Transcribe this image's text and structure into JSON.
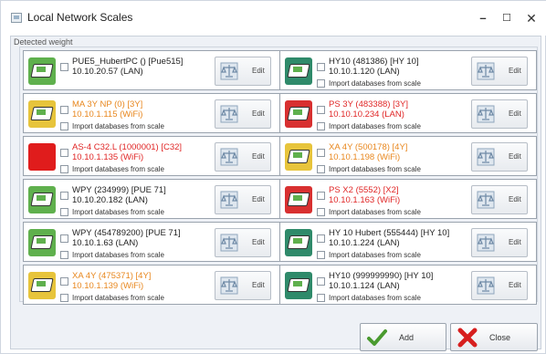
{
  "window": {
    "title": "Local Network Scales"
  },
  "group_label": "Detected weight",
  "colors": {
    "online": "#222222",
    "offline": "#e8871e",
    "error": "#e02626"
  },
  "cards": [
    {
      "name": "PUE5_HubertPC () [Pue515]",
      "address": "10.10.20.57 (LAN)",
      "status": "online",
      "icon_bg": "#5fb04d",
      "import_label": "",
      "edit_label": "Edit"
    },
    {
      "name": "HY10 (481386) [HY 10]",
      "address": "10.10.1.120 (LAN)",
      "status": "online",
      "icon_bg": "#2f8a6a",
      "import_label": "Import databases from scale",
      "edit_label": "Edit"
    },
    {
      "name": "MA 3Y NP (0) [3Y]",
      "address": "10.10.1.115 (WiFi)",
      "status": "offline",
      "icon_bg": "#e7c43b",
      "import_label": "Import databases from scale",
      "edit_label": "Edit"
    },
    {
      "name": "PS 3Y (483388) [3Y]",
      "address": "10.10.10.234 (LAN)",
      "status": "error",
      "icon_bg": "#d83030",
      "import_label": "Import databases from scale",
      "edit_label": "Edit"
    },
    {
      "name": "AS-4 C32.L (1000001) [C32]",
      "address": "10.10.1.135 (WiFi)",
      "status": "error",
      "icon_bg": "#e01c1c",
      "import_label": "Import databases from scale",
      "edit_label": "Edit"
    },
    {
      "name": "XA 4Y (500178) [4Y]",
      "address": "10.10.1.198 (WiFi)",
      "status": "offline",
      "icon_bg": "#e7c43b",
      "import_label": "Import databases from scale",
      "edit_label": "Edit"
    },
    {
      "name": "WPY (234999) [PUE 71]",
      "address": "10.10.20.182 (LAN)",
      "status": "online",
      "icon_bg": "#5fb04d",
      "import_label": "Import databases from scale",
      "edit_label": "Edit"
    },
    {
      "name": "PS X2 (5552) [X2]",
      "address": "10.10.1.163 (WiFi)",
      "status": "error",
      "icon_bg": "#d83030",
      "import_label": "Import databases from scale",
      "edit_label": "Edit"
    },
    {
      "name": "WPY (454789200) [PUE 71]",
      "address": "10.10.1.63 (LAN)",
      "status": "online",
      "icon_bg": "#5fb04d",
      "import_label": "Import databases from scale",
      "edit_label": "Edit"
    },
    {
      "name": "HY 10 Hubert (555444) [HY 10]",
      "address": "10.10.1.224 (LAN)",
      "status": "online",
      "icon_bg": "#2f8a6a",
      "import_label": "Import databases from scale",
      "edit_label": "Edit"
    },
    {
      "name": "XA 4Y (475371) [4Y]",
      "address": "10.10.1.139 (WiFi)",
      "status": "offline",
      "icon_bg": "#e7c43b",
      "import_label": "Import databases from scale",
      "edit_label": "Edit"
    },
    {
      "name": "HY10 (999999990) [HY 10]",
      "address": "10.10.1.124 (LAN)",
      "status": "online",
      "icon_bg": "#2f8a6a",
      "import_label": "Import databases from scale",
      "edit_label": "Edit"
    }
  ],
  "buttons": {
    "add": "Add",
    "close": "Close"
  },
  "icons": {
    "scale": "scale-device-icon",
    "edit": "scale-edit-icon",
    "add": "checkmark-icon",
    "close": "red-x-icon"
  }
}
